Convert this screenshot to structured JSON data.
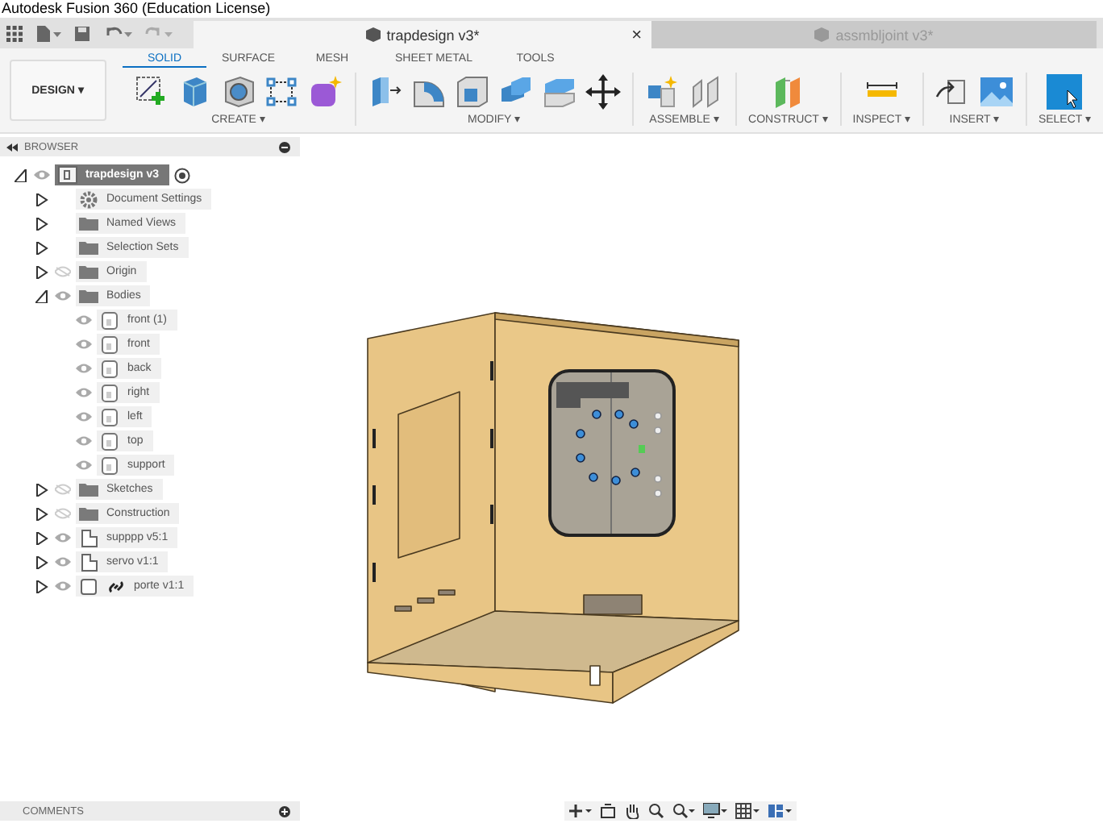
{
  "window": {
    "title": "Autodesk Fusion 360 (Education License)"
  },
  "documents": [
    {
      "title": "trapdesign v3*",
      "selected": true,
      "close": "×"
    },
    {
      "title": "assmbljoint v3*",
      "selected": false
    }
  ],
  "workspace": {
    "label": "DESIGN ▾"
  },
  "ribbon_tabs": [
    {
      "label": "SOLID",
      "selected": true
    },
    {
      "label": "SURFACE",
      "selected": false
    },
    {
      "label": "MESH",
      "selected": false
    },
    {
      "label": "SHEET METAL",
      "selected": false
    },
    {
      "label": "TOOLS",
      "selected": false
    }
  ],
  "ribbon_groups": [
    {
      "label": "CREATE ▾",
      "tools": [
        {
          "kind": "sketch"
        },
        {
          "kind": "box"
        },
        {
          "kind": "hole"
        },
        {
          "kind": "pattern"
        },
        {
          "kind": "form"
        }
      ]
    },
    {
      "label": "MODIFY ▾",
      "tools": [
        {
          "kind": "presspull"
        },
        {
          "kind": "fillet"
        },
        {
          "kind": "shell"
        },
        {
          "kind": "combine"
        },
        {
          "kind": "split"
        },
        {
          "kind": "move"
        }
      ]
    },
    {
      "label": "ASSEMBLE ▾",
      "tools": [
        {
          "kind": "component"
        },
        {
          "kind": "joint"
        }
      ]
    },
    {
      "label": "CONSTRUCT ▾",
      "tools": [
        {
          "kind": "plane"
        }
      ]
    },
    {
      "label": "INSPECT ▾",
      "tools": [
        {
          "kind": "measure"
        }
      ]
    },
    {
      "label": "INSERT ▾",
      "tools": [
        {
          "kind": "insert"
        },
        {
          "kind": "image"
        }
      ]
    },
    {
      "label": "SELECT ▾",
      "tools": [
        {
          "kind": "select"
        }
      ]
    }
  ],
  "browser": {
    "title": "BROWSER",
    "tree": [
      {
        "label": "trapdesign v3",
        "kind": "document",
        "expanded": true,
        "visible": true,
        "selected": true,
        "children": [
          {
            "label": "Document Settings",
            "kind": "settings",
            "expanded": false,
            "selected": false
          },
          {
            "label": "Named Views",
            "kind": "folder",
            "expanded": false,
            "selected": false
          },
          {
            "label": "Selection Sets",
            "kind": "folder",
            "expanded": false,
            "selected": false
          },
          {
            "label": "Origin",
            "kind": "folder",
            "expanded": false,
            "visible": false,
            "selected": false
          },
          {
            "label": "Bodies",
            "kind": "folder",
            "expanded": true,
            "visible": true,
            "selected": false,
            "children": [
              {
                "label": "front (1)",
                "kind": "body",
                "visible": true,
                "selected": false
              },
              {
                "label": "front",
                "kind": "body",
                "visible": true,
                "selected": false
              },
              {
                "label": "back",
                "kind": "body",
                "visible": true,
                "selected": false
              },
              {
                "label": "right",
                "kind": "body",
                "visible": true,
                "selected": false
              },
              {
                "label": "left",
                "kind": "body",
                "visible": true,
                "selected": false
              },
              {
                "label": "top",
                "kind": "body",
                "visible": true,
                "selected": false
              },
              {
                "label": "support",
                "kind": "body",
                "visible": true,
                "selected": false
              }
            ]
          },
          {
            "label": "Sketches",
            "kind": "folder",
            "expanded": false,
            "visible": false,
            "selected": false
          },
          {
            "label": "Construction",
            "kind": "folder",
            "expanded": false,
            "visible": false,
            "selected": false
          },
          {
            "label": "supppp v5:1",
            "kind": "component",
            "expanded": false,
            "visible": true,
            "selected": false
          },
          {
            "label": "servo v1:1",
            "kind": "component",
            "expanded": false,
            "visible": true,
            "selected": false
          },
          {
            "label": "porte v1:1",
            "kind": "linked-component",
            "expanded": false,
            "visible": true,
            "selected": false
          }
        ]
      }
    ]
  },
  "comments": {
    "title": "COMMENTS"
  }
}
